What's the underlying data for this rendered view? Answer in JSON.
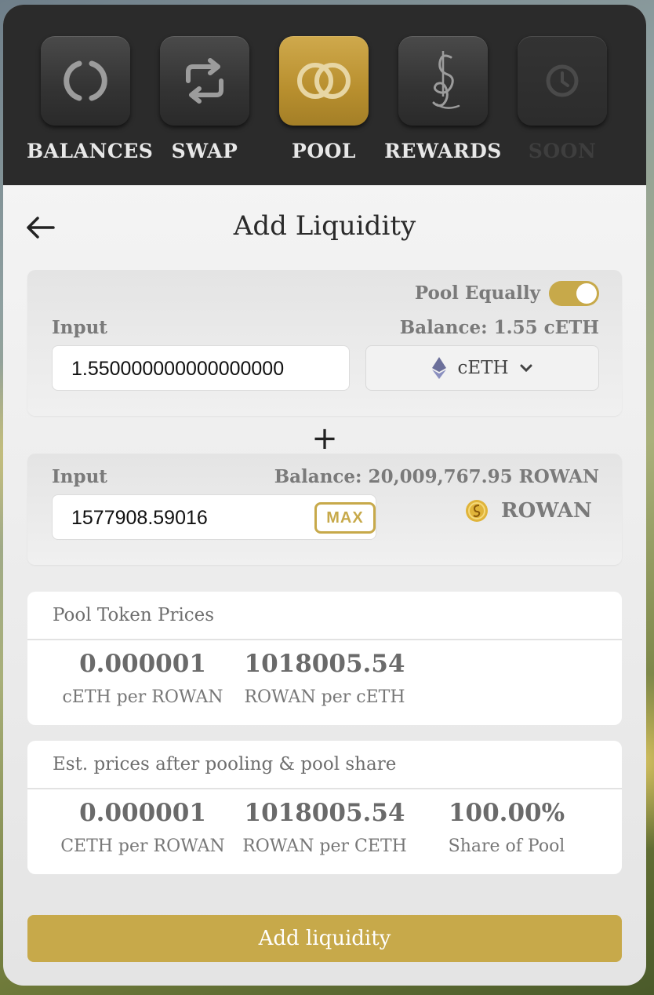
{
  "nav": {
    "items": [
      {
        "label": "BALANCES",
        "icon": "balances-ring-icon"
      },
      {
        "label": "SWAP",
        "icon": "swap-arrows-icon"
      },
      {
        "label": "POOL",
        "icon": "pool-rings-icon"
      },
      {
        "label": "REWARDS",
        "icon": "rewards-script-icon"
      },
      {
        "label": "SOON",
        "icon": "clock-icon"
      }
    ],
    "active_color": "#c7a94a"
  },
  "page": {
    "title": "Add Liquidity"
  },
  "first_input": {
    "pool_equally_label": "Pool Equally",
    "input_label": "Input",
    "balance": "Balance: 1.55 cETH",
    "value": "1.550000000000000000",
    "token": "cETH"
  },
  "plus": "+",
  "second_input": {
    "input_label": "Input",
    "balance": "Balance: 20,009,767.95 ROWAN",
    "value": "1577908.59016",
    "max_label": "MAX",
    "token": "ROWAN"
  },
  "pool_token_prices": {
    "heading": "Pool Token Prices",
    "stats": [
      {
        "value": "0.000001",
        "label": "cETH per ROWAN"
      },
      {
        "value": "1018005.54",
        "label": "ROWAN per cETH"
      }
    ]
  },
  "est_prices": {
    "heading": "Est. prices after pooling & pool share",
    "stats": [
      {
        "value": "0.000001",
        "label": "CETH per ROWAN"
      },
      {
        "value": "1018005.54",
        "label": "ROWAN per CETH"
      },
      {
        "value": "100.00%",
        "label": "Share of Pool"
      }
    ]
  },
  "add_button": {
    "label": "Add liquidity"
  }
}
